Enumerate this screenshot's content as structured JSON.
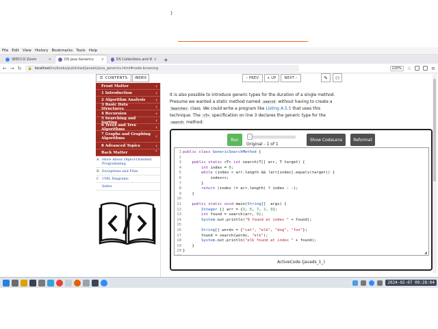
{
  "top_strip": {
    "code_tail": "  }"
  },
  "browser": {
    "menu": [
      "File",
      "Edit",
      "View",
      "History",
      "Bookmarks",
      "Tools",
      "Help"
    ],
    "tabs": [
      {
        "title": "SEECCO Zoom",
        "color": "#2d8cff",
        "active": false
      },
      {
        "title": "DS java Generics",
        "color": "#7a5cc8",
        "active": true
      },
      {
        "title": "DS Collections and Wrappers",
        "color": "#7a5cc8",
        "active": false
      }
    ],
    "url_host": "localhost",
    "url_path": "/ns/books/published/javads/java_generics.html#node-browsing",
    "zoom": "120%"
  },
  "toolbar": {
    "contents": "CONTENTS",
    "index": "INDEX",
    "prev": "‹ PREV",
    "up": "∧ UP",
    "next": "NEXT ›"
  },
  "sidebar": {
    "chapters": [
      {
        "label": "Front Matter",
        "chev": "‹"
      },
      {
        "label": "1  Introduction",
        "chev": "‹"
      },
      {
        "label": "2  Algorithm Analysis",
        "chev": "‹"
      },
      {
        "label": "3  Basic Data Structures",
        "chev": "‹"
      },
      {
        "label": "4  Recursion",
        "chev": "‹"
      },
      {
        "label": "5  Searching and Sorting",
        "chev": "‹"
      },
      {
        "label": "6  Trees and Tree Algorithms",
        "chev": "‹"
      },
      {
        "label": "7  Graphs and Graphing Algorithms",
        "chev": "‹"
      },
      {
        "label": "8  Advanced Topics",
        "chev": "‹"
      },
      {
        "label": "Back Matter",
        "chev": "˅"
      }
    ],
    "subitems": [
      {
        "letter": "A",
        "label": "More About Object-Oriented Programming"
      },
      {
        "letter": "B",
        "label": "Exceptions and Files"
      },
      {
        "letter": "C",
        "label": "UML Diagrams"
      },
      {
        "letter": "",
        "label": "Index"
      }
    ]
  },
  "main": {
    "p1": "It is also possible to introduce generic types for the duration of a single method. Presume we wanted a static method named ",
    "code_search": "search",
    "p2": " without having to create a ",
    "code_searcher": "Searcher",
    "p3": " class. We could write a program like ",
    "listing_link": "Listing A.5.5",
    "p4": " that uses this technique. The ",
    "code_t": "<T>",
    "p5": " specification on line 3 declares the generic type for the ",
    "code_search2": "search",
    "p6": " method:"
  },
  "activecode": {
    "run": "Run",
    "version": "Original - 1 of 1",
    "codelens": "Show CodeLens",
    "reformat": "Reformat",
    "caption": "ActiveCode (javads_1_)",
    "lines": [
      "public class GenericSearchMethod {",
      "",
      "    public static <T> int search(T[] arr, T target) {",
      "        int index = 0;",
      "        while (index < arr.length && !arr[index].equals(target)) {",
      "            index++;",
      "        }",
      "        return (index != arr.length) ? index : -1;",
      "    }",
      "",
      "    public static void main(String[]  args) {",
      "        Integer [] arr = {3, 5, 7, 2, 9};",
      "        int found = search(arr, 9);",
      "        System.out.println(\"9 found at index \" + found);",
      "",
      "        String[] words = {\"cat\", \"elk\", \"dog\", \"fox\"};",
      "        found = search(words, \"elk\");",
      "        System.out.println(\"elk found at index \" + found);",
      "    }",
      "}",
      ""
    ],
    "line_numbers": [
      "1",
      "2",
      "3",
      "4",
      "5",
      "6",
      "7",
      "8",
      "9",
      "10",
      "11",
      "12",
      "13",
      "14",
      "15",
      "16",
      "17",
      "18",
      "19",
      "20",
      "21"
    ]
  },
  "taskbar": {
    "clock": "2024-02-07  09:28:04"
  },
  "colors": {
    "chapter_bg": "#9b2a22",
    "run_green": "#5cb85c",
    "dark_button": "#505050",
    "keyword": "#7a1fa2",
    "type": "#1a55b3",
    "number": "#118a3c",
    "string": "#b3262b"
  }
}
